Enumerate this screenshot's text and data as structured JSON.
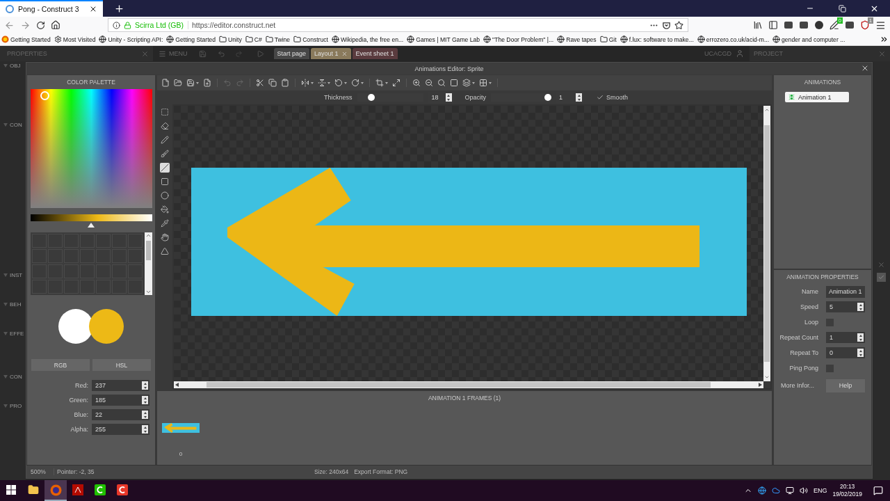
{
  "browser": {
    "tab_title": "Pong - Construct 3",
    "identity": "Scirra Ltd (GB)",
    "url": "https://editor.construct.net",
    "bookmarks": [
      {
        "kind": "firefox",
        "label": "Getting Started"
      },
      {
        "kind": "gear",
        "label": "Most Visited"
      },
      {
        "kind": "globe",
        "label": "Unity - Scripting API:"
      },
      {
        "kind": "globe",
        "label": "Getting Started"
      },
      {
        "kind": "folder",
        "label": "Unity"
      },
      {
        "kind": "folder",
        "label": "C#"
      },
      {
        "kind": "folder",
        "label": "Twine"
      },
      {
        "kind": "folder",
        "label": "Construct"
      },
      {
        "kind": "globe",
        "label": "Wikipedia, the free en..."
      },
      {
        "kind": "globe",
        "label": "Games | MIT Game Lab"
      },
      {
        "kind": "globe",
        "label": "\"The Door Problem\" |..."
      },
      {
        "kind": "globe",
        "label": "Rave tapes"
      },
      {
        "kind": "folder",
        "label": "Git"
      },
      {
        "kind": "globe",
        "label": "f.lux: software to make..."
      },
      {
        "kind": "globe",
        "label": "errozero.co.uk/acid-m..."
      },
      {
        "kind": "globe",
        "label": "gender and computer ..."
      }
    ],
    "extensions": [
      {
        "kind": "library"
      },
      {
        "kind": "sidebar"
      },
      {
        "kind": "extension"
      },
      {
        "kind": "extension"
      },
      {
        "kind": "circle"
      },
      {
        "kind": "pen",
        "badge": "0",
        "color": "#22bb22"
      },
      {
        "kind": "extension"
      },
      {
        "kind": "shield",
        "badge": "1",
        "color": "#888888"
      }
    ]
  },
  "editor": {
    "properties_title": "PROPERTIES",
    "sections": [
      "OBJ",
      "CON",
      "INST",
      "BEH",
      "EFFE",
      "CON",
      "PRO"
    ],
    "menu": "MENU",
    "tabs": [
      {
        "label": "Start page",
        "selected": false,
        "color": "#474747"
      },
      {
        "label": "Layout 1",
        "selected": true,
        "color": "#8a7a5c"
      },
      {
        "label": "Event sheet 1",
        "selected": false,
        "color": "#5a3b3e"
      }
    ],
    "user": "UCACGD",
    "project_title": "PROJECT",
    "side_checkbox": {
      "checked": true
    }
  },
  "dialog": {
    "title": "Animations Editor: Sprite",
    "palette": {
      "title": "COLOR PALETTE",
      "brightness": {
        "level": 0.5
      },
      "current_colors": [
        {
          "color": "#ffffff"
        },
        {
          "color": "#edb916"
        }
      ],
      "modes": [
        "RGB",
        "HSL"
      ],
      "channels": [
        {
          "label": "Red:",
          "value": "237"
        },
        {
          "label": "Green:",
          "value": "185"
        },
        {
          "label": "Blue:",
          "value": "22"
        },
        {
          "label": "Alpha:",
          "value": "255"
        }
      ]
    },
    "toolbar": [
      [
        {
          "kind": "new"
        },
        {
          "kind": "open"
        },
        {
          "kind": "save",
          "dropdown": true
        },
        {
          "kind": "export"
        }
      ],
      [
        {
          "kind": "undo",
          "disabled": true
        },
        {
          "kind": "redo",
          "disabled": true
        }
      ],
      [
        {
          "kind": "cut"
        },
        {
          "kind": "copy"
        },
        {
          "kind": "paste"
        }
      ],
      [
        {
          "kind": "flip_h",
          "dropdown": true
        },
        {
          "kind": "flip_v",
          "dropdown": true
        },
        {
          "kind": "rotate_ccw",
          "dropdown": true
        },
        {
          "kind": "rotate_cw",
          "dropdown": true
        }
      ],
      [
        {
          "kind": "crop",
          "dropdown": true
        },
        {
          "kind": "resize"
        }
      ],
      [
        {
          "kind": "zoom_in"
        },
        {
          "kind": "zoom_out"
        },
        {
          "kind": "zoom_reset"
        },
        {
          "kind": "color"
        },
        {
          "kind": "layers",
          "dropdown": true
        },
        {
          "kind": "grid",
          "dropdown": true
        }
      ]
    ],
    "options": {
      "thickness": {
        "label": "Thickness",
        "level": 0.22,
        "value": "18"
      },
      "opacity": {
        "label": "Opacity",
        "level": 0.95,
        "value": "1"
      },
      "smooth": {
        "label": "Smooth",
        "checked": true
      }
    },
    "tools": [
      {
        "kind": "select",
        "selected": false
      },
      {
        "kind": "eraser",
        "selected": false
      },
      {
        "kind": "pencil",
        "selected": false
      },
      {
        "kind": "brush",
        "selected": false
      },
      {
        "kind": "line",
        "selected": true
      },
      {
        "kind": "rectangle",
        "selected": false
      },
      {
        "kind": "ellipse",
        "selected": false
      },
      {
        "kind": "fill",
        "selected": false
      },
      {
        "kind": "picker",
        "selected": false
      },
      {
        "kind": "pointer",
        "selected": false
      },
      {
        "kind": "polygon",
        "selected": false
      }
    ],
    "frames": {
      "title": "ANIMATION 1 FRAMES (1)",
      "items": [
        {
          "label": "0"
        }
      ]
    },
    "animations": {
      "title": "ANIMATIONS",
      "items": [
        {
          "label": "Animation 1",
          "selected": true
        }
      ]
    },
    "properties": {
      "title": "ANIMATION PROPERTIES",
      "rows": [
        {
          "kind": "text",
          "label": "Name",
          "value": "Animation 1"
        },
        {
          "kind": "number",
          "label": "Speed",
          "value": "5"
        },
        {
          "kind": "checkbox",
          "label": "Loop",
          "checked": false
        },
        {
          "kind": "number",
          "label": "Repeat Count",
          "value": "1"
        },
        {
          "kind": "number",
          "label": "Repeat To",
          "value": "0"
        },
        {
          "kind": "checkbox",
          "label": "Ping Pong",
          "checked": false
        },
        {
          "kind": "link",
          "label": "More Infor...",
          "button": "Help"
        }
      ]
    },
    "status": {
      "zoom": "500%",
      "pointer": "Pointer: -2, 35",
      "size": "Size: 240x64",
      "format": "Export Format: PNG"
    }
  },
  "taskbar": {
    "apps": [
      {
        "kind": "explorer",
        "selected": false
      },
      {
        "kind": "firefox",
        "selected": true
      },
      {
        "kind": "acrobat",
        "selected": false
      },
      {
        "kind": "green_app",
        "selected": false
      },
      {
        "kind": "red_app",
        "selected": false
      }
    ],
    "language": "ENG",
    "time": "20:13",
    "date": "19/02/2019"
  }
}
